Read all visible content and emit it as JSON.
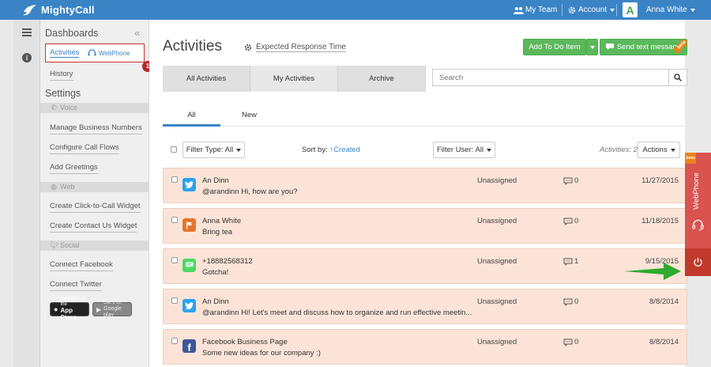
{
  "topbar": {
    "brand": "MightyCall",
    "my_team": "My Team",
    "account": "Account",
    "avatar_letter": "A",
    "user_name": "Anna White"
  },
  "sidebar": {
    "dashboards_title": "Dashboards",
    "activities_link": "Activities",
    "webphone_link": "WebPhone",
    "badge_count": "1",
    "history_link": "History",
    "settings_title": "Settings",
    "sections": {
      "voice": "Voice",
      "web": "Web",
      "social": "Social"
    },
    "voice_links": [
      "Manage Business Numbers",
      "Configure Call Flows",
      "Add Greetings"
    ],
    "web_links": [
      "Create Click-to-Call Widget",
      "Create Contact Us Widget"
    ],
    "social_links": [
      "Connect Facebook",
      "Connect Twitter"
    ],
    "app_store": {
      "line1": "Available on the",
      "line2": "App Store"
    },
    "google_play": {
      "line1": "Get it on",
      "line2": "Google play"
    }
  },
  "main": {
    "title": "Activities",
    "expected_response": "Expected Response Time",
    "add_todo": "Add To Do Item",
    "send_text": "Send text message",
    "beta": "beta",
    "tabs": [
      "All Activities",
      "My Activities",
      "Archive"
    ],
    "search_placeholder": "Search",
    "subtabs": [
      "All",
      "New"
    ],
    "filter_type": "Filter Type: All",
    "sort_by_label": "Sort by:",
    "sort_by_value": "Created",
    "filter_user": "Filter User: All",
    "activities_count": "Activities: 2",
    "actions": "Actions"
  },
  "rows": [
    {
      "channel": "twitter",
      "name": "An Dinn",
      "message": "@arandinn Hi, how are you?",
      "assigned": "Unassigned",
      "comments": "0",
      "date": "11/27/2015"
    },
    {
      "channel": "todo",
      "name": "Anna White",
      "message": "Bring tea",
      "assigned": "Unassigned",
      "comments": "0",
      "date": "11/18/2015"
    },
    {
      "channel": "sms",
      "name": "+18882568312",
      "message": "Gotcha!",
      "assigned": "Unassigned",
      "comments": "1",
      "date": "9/15/2015"
    },
    {
      "channel": "twitter",
      "name": "An Dinn",
      "message": "@arandinn Hi! Let's meet and discuss how to organize and run effective meetin...",
      "assigned": "Unassigned",
      "comments": "0",
      "date": "8/8/2014"
    },
    {
      "channel": "facebook",
      "name": "Facebook Business Page",
      "message": "Some new ideas for our company :)",
      "assigned": "Unassigned",
      "comments": "0",
      "date": "8/8/2014"
    }
  ],
  "webphone_widget": {
    "label": "WebPhone",
    "beta": "beta"
  },
  "colors": {
    "topbar": "#3a84c6",
    "green": "#5cb85c",
    "row_bg": "#fbe4d7",
    "webphone": "#d9534f",
    "arrow": "#2eaa2e"
  },
  "icons": {
    "twitter": "twitter-icon",
    "todo": "flag-icon",
    "sms": "sms-icon",
    "facebook": "facebook-icon",
    "comment": "comment-icon"
  }
}
